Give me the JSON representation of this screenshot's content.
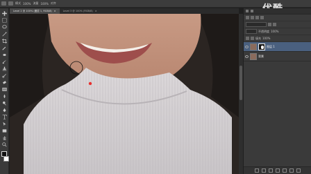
{
  "watermark": {
    "text": "优酷"
  },
  "options_bar": {
    "items": [
      {
        "text": "模式"
      },
      {
        "text": "100%"
      },
      {
        "text": "流量"
      },
      {
        "text": "100%"
      },
      {
        "text": "对齐"
      }
    ]
  },
  "tabs": [
    {
      "label": "Level 2 @ 100% (图层 1, RGB/8)",
      "close": "×",
      "active": true
    },
    {
      "label": "Level 3 @ 100% (RGB/8)",
      "close": "×",
      "active": false
    }
  ],
  "panels": {
    "opacity_label": "不透明度",
    "opacity_value": "100%",
    "fill_label": "填充",
    "fill_value": "100%",
    "layers": [
      {
        "name": "图层 1",
        "selected": true,
        "has_mask": true
      },
      {
        "name": "背景",
        "selected": false,
        "has_mask": false
      }
    ]
  },
  "colors": {
    "ps_bg": "#3a3a3a",
    "selected_layer": "#4a607f",
    "brush_marker": "#e8302f"
  },
  "canvas_subject": "woman-in-white-turtleneck"
}
